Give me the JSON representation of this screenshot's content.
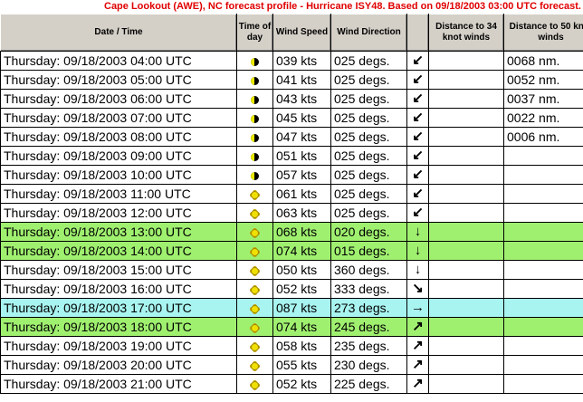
{
  "banner": "Cape Lookout (AWE), NC forecast profile - Hurricane ISY48. Based on 09/18/2003 03:00 UTC forecast.",
  "columns": [
    "Date / Time",
    "Time of day",
    "Wind Speed",
    "Wind Direction",
    "",
    "Distance to 34 knot winds",
    "Distance to 50 knot winds"
  ],
  "rows": [
    {
      "dt": "Thursday: 09/18/2003 04:00 UTC",
      "tod": "moon-icon",
      "speed": "039 kts",
      "dir": "025 degs.",
      "arrow": "↙",
      "d34": "",
      "d50": "0068 nm.",
      "hl": ""
    },
    {
      "dt": "Thursday: 09/18/2003 05:00 UTC",
      "tod": "moon-icon",
      "speed": "041 kts",
      "dir": "025 degs.",
      "arrow": "↙",
      "d34": "",
      "d50": "0052 nm.",
      "hl": ""
    },
    {
      "dt": "Thursday: 09/18/2003 06:00 UTC",
      "tod": "moon-icon",
      "speed": "043 kts",
      "dir": "025 degs.",
      "arrow": "↙",
      "d34": "",
      "d50": "0037 nm.",
      "hl": ""
    },
    {
      "dt": "Thursday: 09/18/2003 07:00 UTC",
      "tod": "moon-icon",
      "speed": "045 kts",
      "dir": "025 degs.",
      "arrow": "↙",
      "d34": "",
      "d50": "0022 nm.",
      "hl": ""
    },
    {
      "dt": "Thursday: 09/18/2003 08:00 UTC",
      "tod": "moon-icon",
      "speed": "047 kts",
      "dir": "025 degs.",
      "arrow": "↙",
      "d34": "",
      "d50": "0006 nm.",
      "hl": ""
    },
    {
      "dt": "Thursday: 09/18/2003 09:00 UTC",
      "tod": "moon-icon",
      "speed": "051 kts",
      "dir": "025 degs.",
      "arrow": "↙",
      "d34": "",
      "d50": "",
      "hl": ""
    },
    {
      "dt": "Thursday: 09/18/2003 10:00 UTC",
      "tod": "moon-icon",
      "speed": "057 kts",
      "dir": "025 degs.",
      "arrow": "↙",
      "d34": "",
      "d50": "",
      "hl": ""
    },
    {
      "dt": "Thursday: 09/18/2003 11:00 UTC",
      "tod": "sun-icon",
      "speed": "061 kts",
      "dir": "025 degs.",
      "arrow": "↙",
      "d34": "",
      "d50": "",
      "hl": ""
    },
    {
      "dt": "Thursday: 09/18/2003 12:00 UTC",
      "tod": "sun-icon",
      "speed": "063 kts",
      "dir": "025 degs.",
      "arrow": "↙",
      "d34": "",
      "d50": "",
      "hl": ""
    },
    {
      "dt": "Thursday: 09/18/2003 13:00 UTC",
      "tod": "sun-icon",
      "speed": "068 kts",
      "dir": "020 degs.",
      "arrow": "↓",
      "d34": "",
      "d50": "",
      "hl": "green"
    },
    {
      "dt": "Thursday: 09/18/2003 14:00 UTC",
      "tod": "sun-icon",
      "speed": "074 kts",
      "dir": "015 degs.",
      "arrow": "↓",
      "d34": "",
      "d50": "",
      "hl": "green"
    },
    {
      "dt": "Thursday: 09/18/2003 15:00 UTC",
      "tod": "sun-icon",
      "speed": "050 kts",
      "dir": "360 degs.",
      "arrow": "↓",
      "d34": "",
      "d50": "",
      "hl": ""
    },
    {
      "dt": "Thursday: 09/18/2003 16:00 UTC",
      "tod": "sun-icon",
      "speed": "052 kts",
      "dir": "333 degs.",
      "arrow": "↘",
      "d34": "",
      "d50": "",
      "hl": ""
    },
    {
      "dt": "Thursday: 09/18/2003 17:00 UTC",
      "tod": "sun-icon",
      "speed": "087 kts",
      "dir": "273 degs.",
      "arrow": "→",
      "d34": "",
      "d50": "",
      "hl": "cyan"
    },
    {
      "dt": "Thursday: 09/18/2003 18:00 UTC",
      "tod": "sun-icon",
      "speed": "074 kts",
      "dir": "245 degs.",
      "arrow": "↗",
      "d34": "",
      "d50": "",
      "hl": "green"
    },
    {
      "dt": "Thursday: 09/18/2003 19:00 UTC",
      "tod": "sun-icon",
      "speed": "058 kts",
      "dir": "235 degs.",
      "arrow": "↗",
      "d34": "",
      "d50": "",
      "hl": ""
    },
    {
      "dt": "Thursday: 09/18/2003 20:00 UTC",
      "tod": "sun-icon",
      "speed": "055 kts",
      "dir": "230 degs.",
      "arrow": "↗",
      "d34": "",
      "d50": "",
      "hl": ""
    },
    {
      "dt": "Thursday: 09/18/2003 21:00 UTC",
      "tod": "sun-icon",
      "speed": "052 kts",
      "dir": "225 degs.",
      "arrow": "↗",
      "d34": "",
      "d50": "",
      "hl": ""
    }
  ],
  "colors": {
    "banner_text": "#e00000",
    "highlight_green": "#a0f070",
    "highlight_cyan": "#a8f4f0",
    "header_bg": "#d4d0c8"
  }
}
